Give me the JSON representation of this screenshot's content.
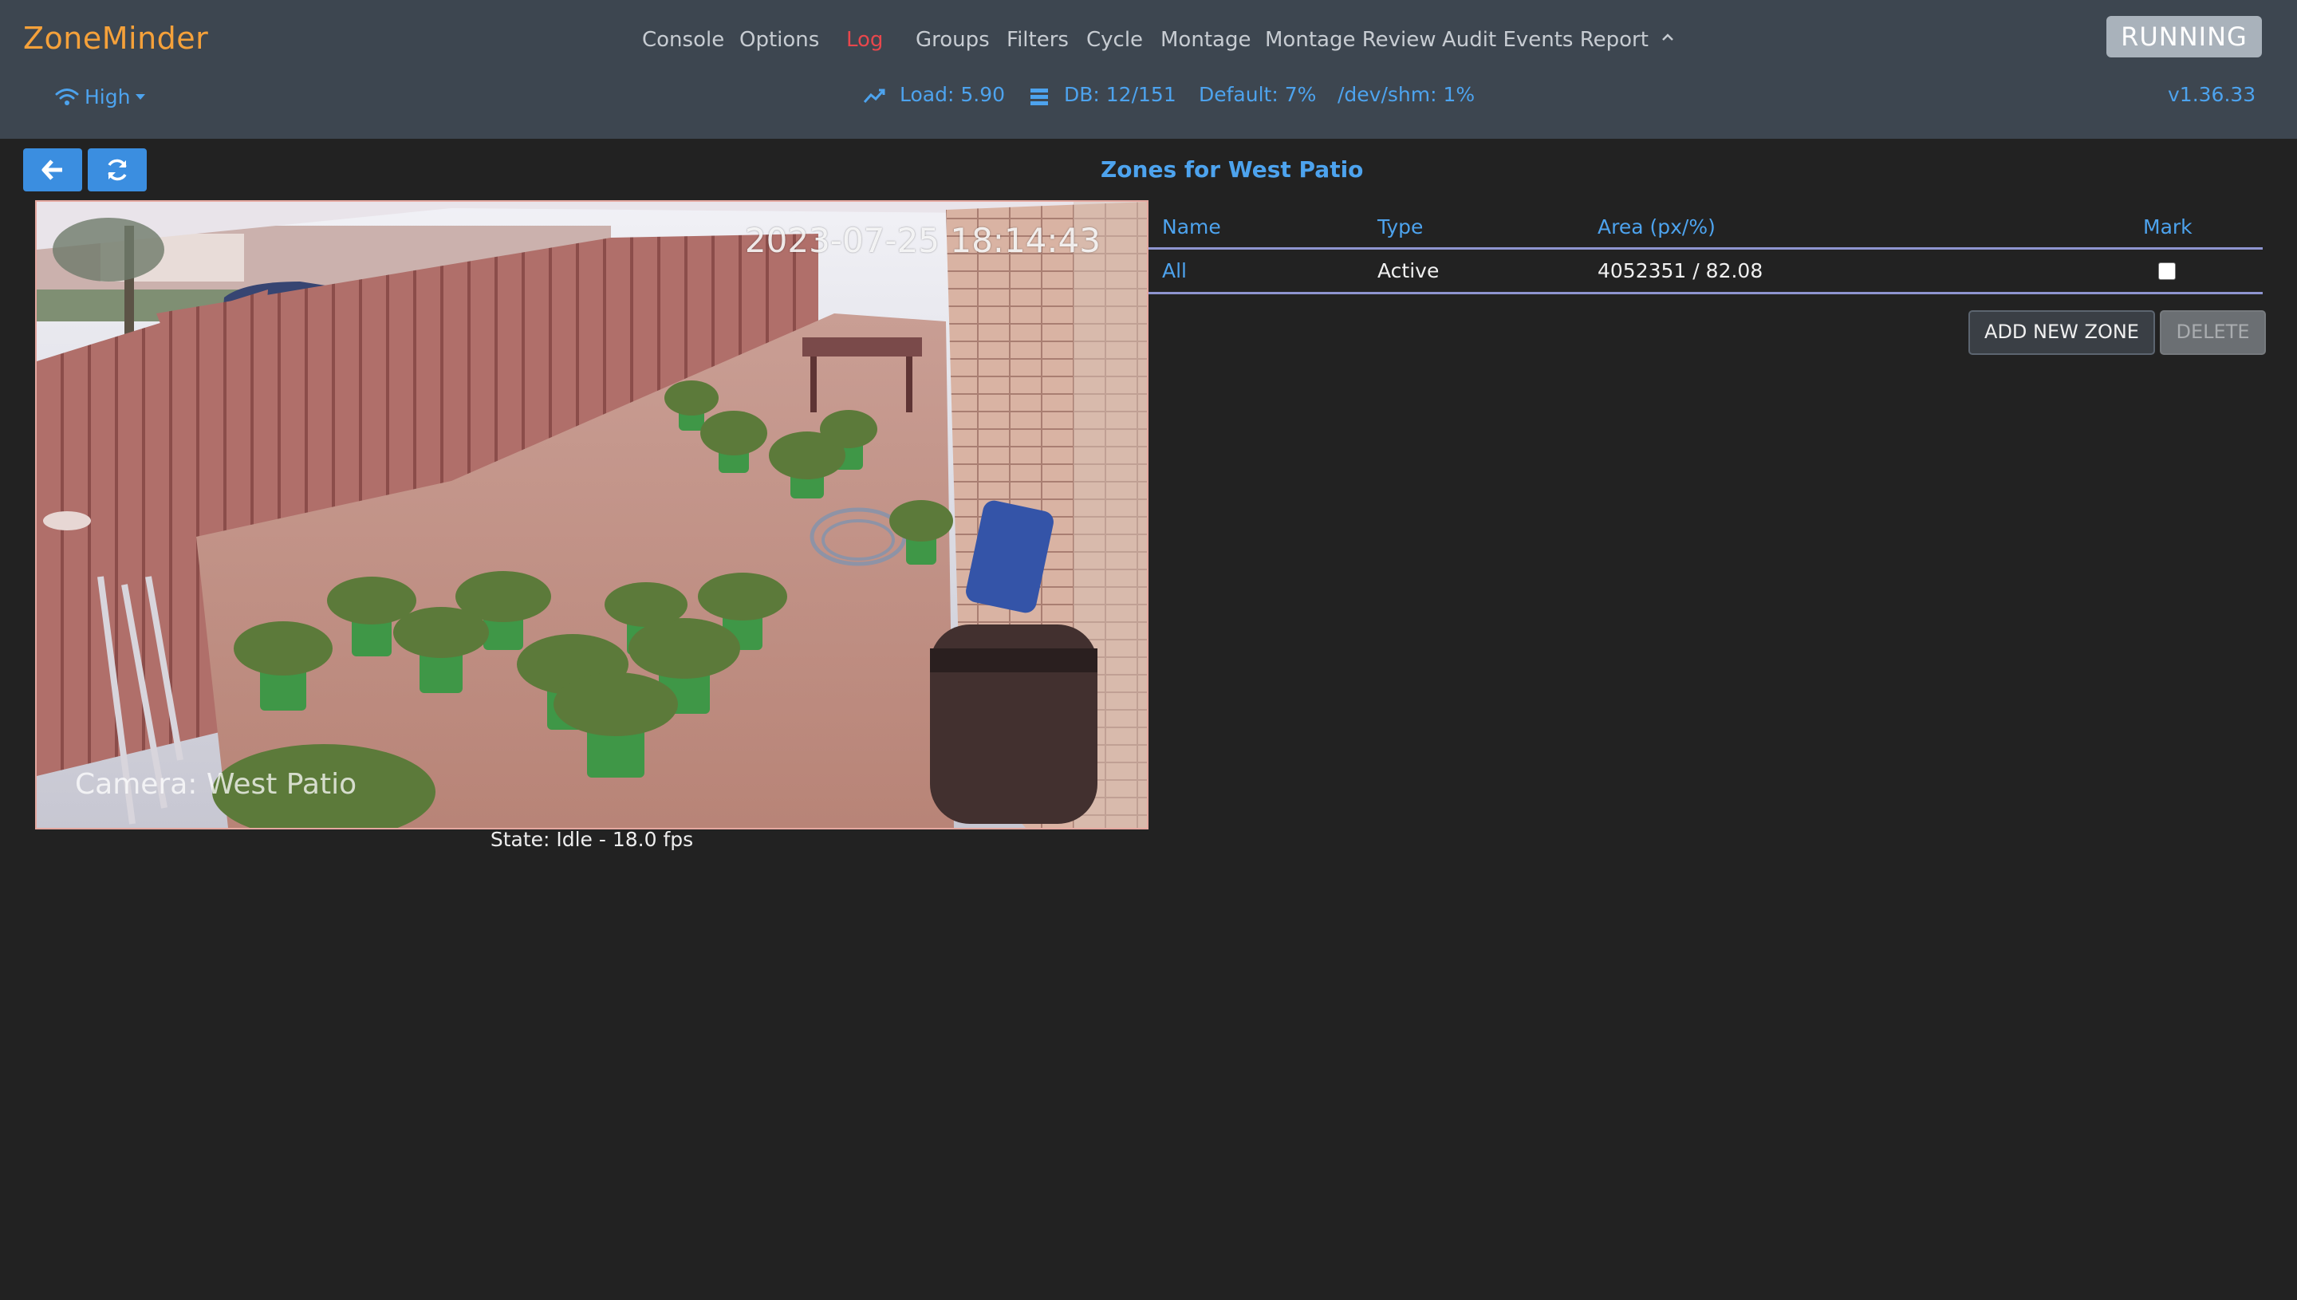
{
  "header": {
    "brand": "ZoneMinder",
    "nav": [
      {
        "label": "Console",
        "active": false
      },
      {
        "label": "Options",
        "active": false
      },
      {
        "label": "Log",
        "active": true
      },
      {
        "label": "Groups",
        "active": false
      },
      {
        "label": "Filters",
        "active": false
      },
      {
        "label": "Cycle",
        "active": false
      },
      {
        "label": "Montage",
        "active": false
      },
      {
        "label": "Montage Review",
        "active": false
      },
      {
        "label": "Audit Events Report",
        "active": false
      }
    ],
    "status": "RUNNING",
    "bandwidth": "High",
    "stats": {
      "load": "Load: 5.90",
      "db": "DB: 12/151",
      "default": "Default: 7%",
      "shm": "/dev/shm: 1%"
    },
    "version": "v1.36.33"
  },
  "page": {
    "title": "Zones for West Patio"
  },
  "camera": {
    "timestamp": "2023-07-25 18:14:43",
    "name_overlay": "Camera: West Patio",
    "state": "State: Idle - 18.0 fps"
  },
  "zones_table": {
    "columns": [
      "Name",
      "Type",
      "Area (px/%)",
      "Mark"
    ],
    "rows": [
      {
        "name": "All",
        "type": "Active",
        "area": "4052351 / 82.08",
        "marked": false
      }
    ]
  },
  "actions": {
    "add": "ADD NEW ZONE",
    "delete": "DELETE"
  },
  "icons": {
    "bandwidth": "wifi-icon",
    "load": "chart-line-icon",
    "db": "database-icon",
    "back": "arrow-left-icon",
    "refresh": "refresh-icon",
    "collapse": "chevron-up-icon"
  },
  "colors": {
    "brand": "#f5a13a",
    "accent": "#4da3ee",
    "active_nav": "#e8474c",
    "header_bg": "#3d4650",
    "page_bg": "#222222"
  }
}
